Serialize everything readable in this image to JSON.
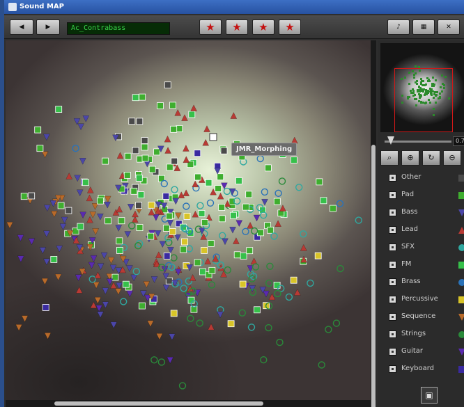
{
  "window": {
    "title": "Sound MAP"
  },
  "toolbar": {
    "prev_label": "◀",
    "next_label": "▶",
    "preset_name": "Ac_Contrabass",
    "star_icon": "★",
    "favorite_slots": [
      "slot-1",
      "slot-2",
      "slot-3",
      "slot-4"
    ],
    "tools": [
      {
        "name": "piano-icon",
        "glyph": "♪"
      },
      {
        "name": "keyboard-icon",
        "glyph": "▦"
      },
      {
        "name": "tools-icon",
        "glyph": "✕"
      }
    ]
  },
  "map": {
    "tooltip": "JMR_Morphing"
  },
  "side_panel": {
    "zoom_readout": "0.7",
    "tool_glyphs": [
      "⌕",
      "⊕",
      "↻",
      "⊖"
    ]
  },
  "categories": [
    {
      "label": "Other",
      "color": "#4a4a4a",
      "shape": "square",
      "visible": true
    },
    {
      "label": "Pad",
      "color": "#3fae2f",
      "shape": "square",
      "visible": true
    },
    {
      "label": "Bass",
      "color": "#4b46a8",
      "shape": "tri-down",
      "visible": true
    },
    {
      "label": "Lead",
      "color": "#b83a34",
      "shape": "tri-up",
      "visible": true
    },
    {
      "label": "SFX",
      "color": "#2fa8a0",
      "shape": "circle",
      "visible": true
    },
    {
      "label": "FM",
      "color": "#36c04a",
      "shape": "square",
      "visible": true
    },
    {
      "label": "Brass",
      "color": "#2a72b8",
      "shape": "circle",
      "visible": true
    },
    {
      "label": "Percussive",
      "color": "#d8c428",
      "shape": "square",
      "visible": true
    },
    {
      "label": "Sequence",
      "color": "#b86a2a",
      "shape": "tri-down",
      "visible": true
    },
    {
      "label": "Strings",
      "color": "#2a8a3a",
      "shape": "circle",
      "visible": true
    },
    {
      "label": "Guitar",
      "color": "#5a2ab0",
      "shape": "tri-down",
      "visible": true
    },
    {
      "label": "Keyboard",
      "color": "#3a2aa0",
      "shape": "square",
      "visible": true
    }
  ]
}
